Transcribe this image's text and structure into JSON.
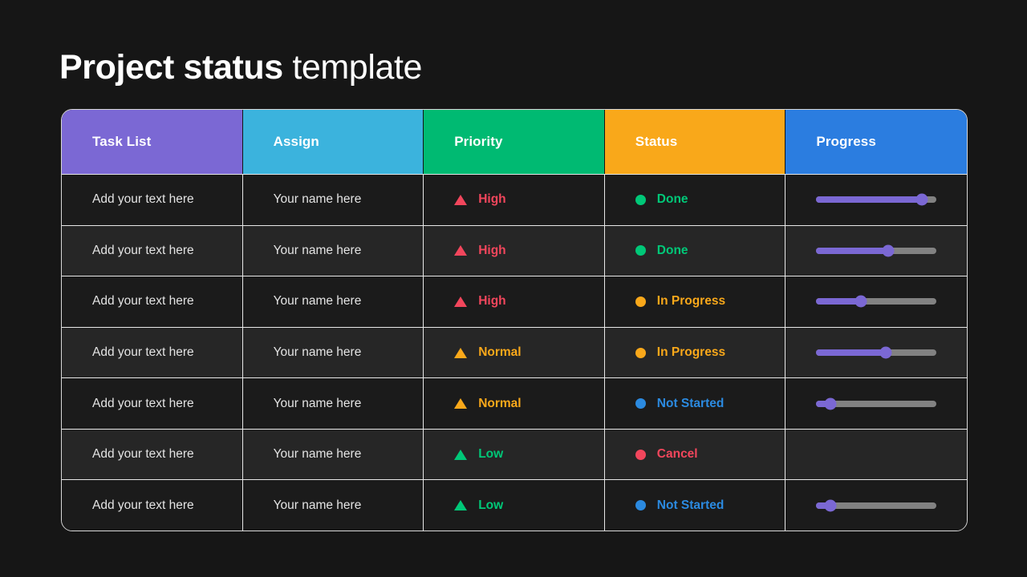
{
  "title": {
    "strong": "Project status",
    "light": " template"
  },
  "palette": {
    "background": "#161616",
    "purple": "#7b68d4",
    "cyan": "#3bb3dd",
    "green": "#00ba72",
    "orange": "#f9a81a",
    "blue": "#2b7de0",
    "red": "#f2465c",
    "track": "#828282",
    "row_odd": "#1b1b1b",
    "row_even": "#262626",
    "grid": "#e8e8e8"
  },
  "table": {
    "columns": [
      {
        "label": "Task List",
        "color": "#7b68d4"
      },
      {
        "label": "Assign",
        "color": "#3bb3dd"
      },
      {
        "label": "Priority",
        "color": "#00ba72"
      },
      {
        "label": "Status",
        "color": "#f9a81a"
      },
      {
        "label": "Progress",
        "color": "#2b7de0"
      }
    ],
    "rows": [
      {
        "task": "Add your text here",
        "assign": "Your name here",
        "priority": {
          "label": "High",
          "color": "#f2465c"
        },
        "status": {
          "label": "Done",
          "color": "#00c878"
        },
        "progress": {
          "value": 88,
          "visible": true
        }
      },
      {
        "task": "Add your text here",
        "assign": "Your name here",
        "priority": {
          "label": "High",
          "color": "#f2465c"
        },
        "status": {
          "label": "Done",
          "color": "#00c878"
        },
        "progress": {
          "value": 60,
          "visible": true
        }
      },
      {
        "task": "Add your text here",
        "assign": "Your name here",
        "priority": {
          "label": "High",
          "color": "#f2465c"
        },
        "status": {
          "label": "In Progress",
          "color": "#f9a81a"
        },
        "progress": {
          "value": 37,
          "visible": true
        }
      },
      {
        "task": "Add your text here",
        "assign": "Your name here",
        "priority": {
          "label": "Normal",
          "color": "#f9a81a"
        },
        "status": {
          "label": "In Progress",
          "color": "#f9a81a"
        },
        "progress": {
          "value": 58,
          "visible": true
        }
      },
      {
        "task": "Add your text here",
        "assign": "Your name here",
        "priority": {
          "label": "Normal",
          "color": "#f9a81a"
        },
        "status": {
          "label": "Not Started",
          "color": "#2b8ae0"
        },
        "progress": {
          "value": 12,
          "visible": true
        }
      },
      {
        "task": "Add your text here",
        "assign": "Your name here",
        "priority": {
          "label": "Low",
          "color": "#00c878"
        },
        "status": {
          "label": "Cancel",
          "color": "#f2465c"
        },
        "progress": {
          "value": 0,
          "visible": false
        }
      },
      {
        "task": "Add your text here",
        "assign": "Your name here",
        "priority": {
          "label": "Low",
          "color": "#00c878"
        },
        "status": {
          "label": "Not Started",
          "color": "#2b8ae0"
        },
        "progress": {
          "value": 12,
          "visible": true
        }
      }
    ]
  }
}
